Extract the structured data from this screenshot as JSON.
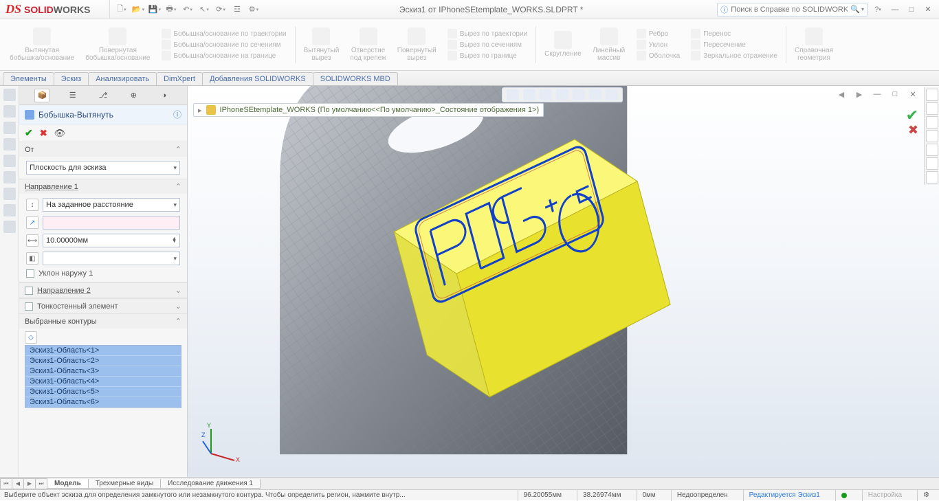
{
  "app": {
    "brand": "SOLIDWORKS",
    "doc_title": "Эскиз1 от IPhoneSEtemplate_WORKS.SLDPRT *"
  },
  "search": {
    "placeholder": "Поиск в Справке по SOLIDWORKS"
  },
  "ribbon": {
    "b1": "Вытянутая\nбобышка/основание",
    "b2": "Повернутая\nбобышка/основание",
    "l1a": "Бобышка/основание по траектории",
    "l1b": "Бобышка/основание по сечениям",
    "l1c": "Бобышка/основание на границе",
    "c1": "Вытянутый\nвырез",
    "c2": "Отверстие\nпод крепеж",
    "c3": "Повернутый\nвырез",
    "l2a": "Вырез по траектории",
    "l2b": "Вырез по сечениям",
    "l2c": "Вырез по границе",
    "f1": "Скругление",
    "f2": "Линейный\nмассив",
    "l3a": "Ребро",
    "l3b": "Уклон",
    "l3c": "Оболочка",
    "l4a": "Перенос",
    "l4b": "Пересечение",
    "l4c": "Зеркальное отражение",
    "g1": "Справочная\nгеометрия"
  },
  "tabs": [
    "Элементы",
    "Эскиз",
    "Анализировать",
    "DimXpert",
    "Добавления SOLIDWORKS",
    "SOLIDWORKS MBD"
  ],
  "fm": {
    "title": "Бобышка-Вытянуть",
    "from_hdr": "От",
    "from_combo": "Плоскость для эскиза",
    "dir1_hdr": "Направление 1",
    "dir1_combo": "На заданное расстояние",
    "depth": "10.00000мм",
    "draft": "Уклон наружу 1",
    "dir2_hdr": "Направление 2",
    "thin_hdr": "Тонкостенный элемент",
    "contours_hdr": "Выбранные контуры",
    "contours": [
      "Эскиз1-Область<1>",
      "Эскиз1-Область<2>",
      "Эскиз1-Область<3>",
      "Эскиз1-Область<4>",
      "Эскиз1-Область<5>",
      "Эскиз1-Область<6>"
    ]
  },
  "breadcrumb": "IPhoneSEtemplate_WORKS  (По умолчанию<<По умолчанию>_Состояние отображения 1>)",
  "bottom": {
    "t1": "Модель",
    "t2": "Трехмерные виды",
    "t3": "Исследование движения 1"
  },
  "status": {
    "msg": "Выберите объект эскиза для определения замкнутого или незамкнутого контура. Чтобы определить регион, нажмите внутр...",
    "x": "96.20055мм",
    "y": "38.26974мм",
    "z": "0мм",
    "def": "Недоопределен",
    "edit": "Редактируется Эскиз1",
    "mode": "Настройка"
  }
}
